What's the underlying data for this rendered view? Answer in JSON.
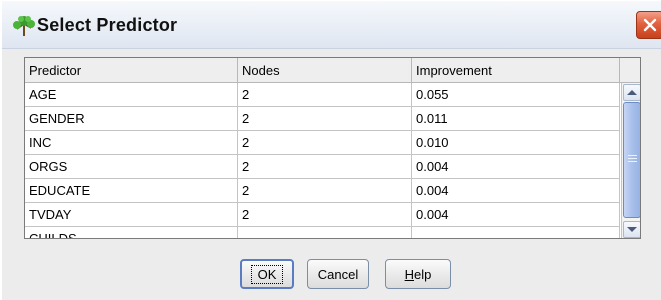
{
  "window": {
    "title": "Select Predictor",
    "icon": "tree-icon",
    "close_icon": "close-icon"
  },
  "table": {
    "headers": [
      "Predictor",
      "Nodes",
      "Improvement"
    ],
    "rows": [
      {
        "predictor": "AGE",
        "nodes": "2",
        "improvement": "0.055"
      },
      {
        "predictor": "GENDER",
        "nodes": "2",
        "improvement": "0.011"
      },
      {
        "predictor": "INC",
        "nodes": "2",
        "improvement": "0.010"
      },
      {
        "predictor": "ORGS",
        "nodes": "2",
        "improvement": "0.004"
      },
      {
        "predictor": "EDUCATE",
        "nodes": "2",
        "improvement": "0.004"
      },
      {
        "predictor": "TVDAY",
        "nodes": "2",
        "improvement": "0.004"
      },
      {
        "predictor": "CHILDS",
        "nodes": "",
        "improvement": ""
      }
    ]
  },
  "buttons": {
    "ok": "OK",
    "cancel": "Cancel",
    "help_first": "H",
    "help_rest": "elp"
  },
  "colors": {
    "close_button": "#d9502c",
    "scroll_thumb": "#a8c0ea"
  }
}
